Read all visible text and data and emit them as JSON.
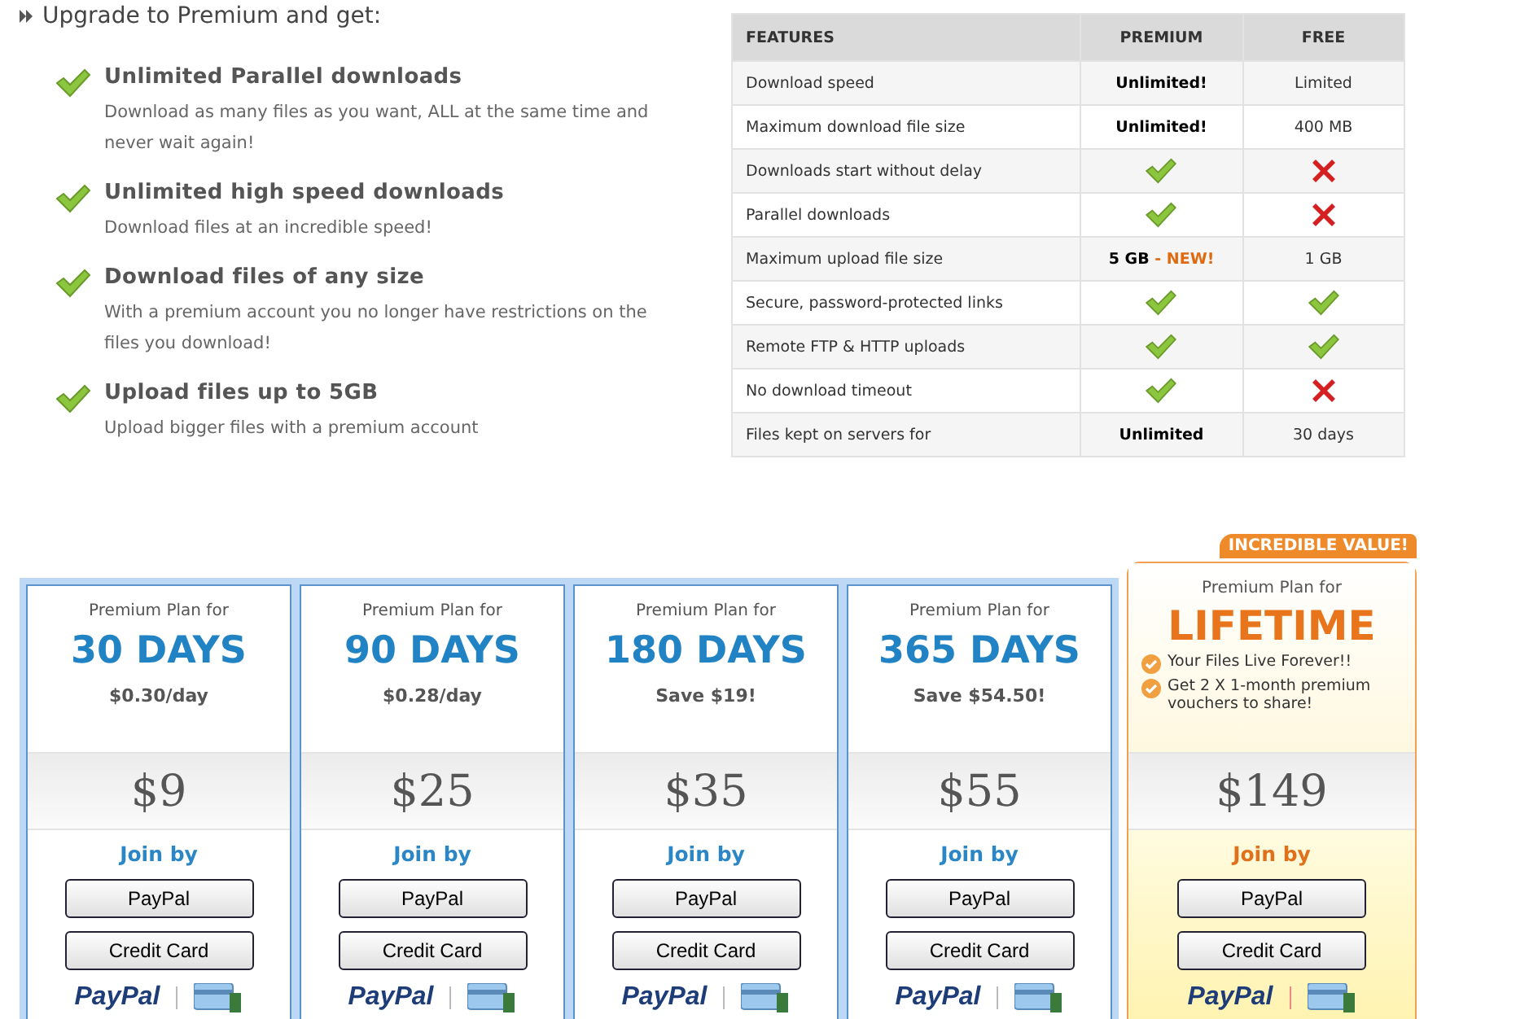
{
  "intro": {
    "heading": "Upgrade to Premium and get:"
  },
  "benefits": [
    {
      "title": "Unlimited Parallel downloads",
      "description": "Download as many files as you want, ALL at the same time and never wait again!"
    },
    {
      "title": "Unlimited high speed downloads",
      "description": "Download files at an incredible speed!"
    },
    {
      "title": "Download files of any size",
      "description": "With a premium account you no longer have restrictions on the files you download!"
    },
    {
      "title": "Upload files up to 5GB",
      "description": "Upload bigger files with a premium account"
    }
  ],
  "comparison": {
    "columns": [
      "FEATURES",
      "PREMIUM",
      "FREE"
    ],
    "rows": [
      {
        "feature": "Download speed",
        "premium": {
          "kind": "text",
          "text": "Unlimited!"
        },
        "free": {
          "kind": "text",
          "text": "Limited"
        }
      },
      {
        "feature": "Maximum download file size",
        "premium": {
          "kind": "text",
          "text": "Unlimited!"
        },
        "free": {
          "kind": "text",
          "text": "400 MB"
        }
      },
      {
        "feature": "Downloads start without delay",
        "premium": {
          "kind": "check"
        },
        "free": {
          "kind": "cross"
        }
      },
      {
        "feature": "Parallel downloads",
        "premium": {
          "kind": "check"
        },
        "free": {
          "kind": "cross"
        }
      },
      {
        "feature": "Maximum upload file size",
        "premium": {
          "kind": "text",
          "text": "5 GB",
          "note": "- NEW!"
        },
        "free": {
          "kind": "text",
          "text": "1 GB"
        }
      },
      {
        "feature": "Secure, password-protected links",
        "premium": {
          "kind": "check"
        },
        "free": {
          "kind": "check"
        }
      },
      {
        "feature": "Remote FTP & HTTP uploads",
        "premium": {
          "kind": "check"
        },
        "free": {
          "kind": "check"
        }
      },
      {
        "feature": "No download timeout",
        "premium": {
          "kind": "check"
        },
        "free": {
          "kind": "cross"
        }
      },
      {
        "feature": "Files kept on servers for",
        "premium": {
          "kind": "text",
          "text": "Unlimited"
        },
        "free": {
          "kind": "text",
          "text": "30 days"
        }
      }
    ]
  },
  "plans": [
    {
      "featured": false,
      "label": "Premium Plan for",
      "term": "30 DAYS",
      "subtitle": "$0.30/day",
      "price": "$9",
      "join": "Join by",
      "buttons": [
        "PayPal",
        "Credit Card"
      ],
      "logo": "PayPal"
    },
    {
      "featured": false,
      "label": "Premium Plan for",
      "term": "90 DAYS",
      "subtitle": "$0.28/day",
      "price": "$25",
      "join": "Join by",
      "buttons": [
        "PayPal",
        "Credit Card"
      ],
      "logo": "PayPal"
    },
    {
      "featured": false,
      "label": "Premium Plan for",
      "term": "180 DAYS",
      "subtitle": "Save $19!",
      "price": "$35",
      "join": "Join by",
      "buttons": [
        "PayPal",
        "Credit Card"
      ],
      "logo": "PayPal"
    },
    {
      "featured": false,
      "label": "Premium Plan for",
      "term": "365 DAYS",
      "subtitle": "Save $54.50!",
      "price": "$55",
      "join": "Join by",
      "buttons": [
        "PayPal",
        "Credit Card"
      ],
      "logo": "PayPal"
    },
    {
      "featured": true,
      "badge": "INCREDIBLE VALUE!",
      "label": "Premium Plan for",
      "term": "LIFETIME",
      "perks": [
        "Your Files Live Forever!!",
        "Get 2 X 1-month premium vouchers to share!"
      ],
      "price": "$149",
      "join": "Join by",
      "buttons": [
        "PayPal",
        "Credit Card"
      ],
      "logo": "PayPal"
    }
  ]
}
